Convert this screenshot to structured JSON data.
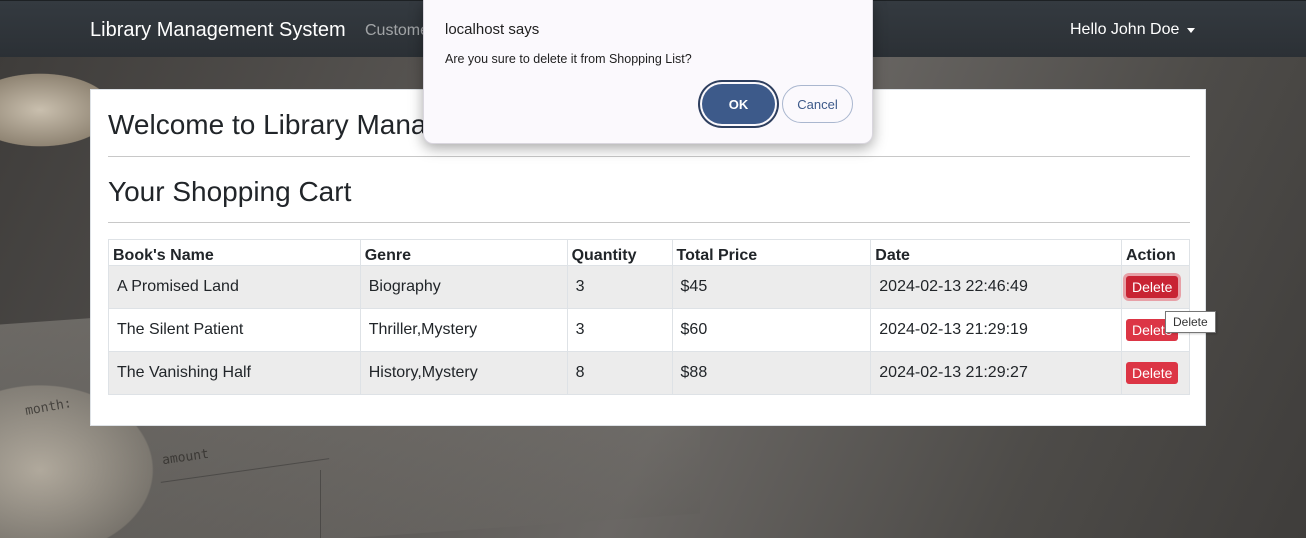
{
  "navbar": {
    "brand": "Library Management System",
    "nav_link": "Custome",
    "user_greeting": "Hello John Doe"
  },
  "main": {
    "welcome_heading": "Welcome to Library Mana",
    "cart_heading": "Your Shopping Cart",
    "table": {
      "headers": [
        "Book's Name",
        "Genre",
        "Quantity",
        "Total Price",
        "Date",
        "Action"
      ],
      "rows": [
        {
          "name": "A Promised Land",
          "genre": "Biography",
          "quantity": "3",
          "price": "$45",
          "date": "2024-02-13 22:46:49",
          "action": "Delete"
        },
        {
          "name": "The Silent Patient",
          "genre": "Thriller,Mystery",
          "quantity": "3",
          "price": "$60",
          "date": "2024-02-13 21:29:19",
          "action": "Delete"
        },
        {
          "name": "The Vanishing Half",
          "genre": "History,Mystery",
          "quantity": "8",
          "price": "$88",
          "date": "2024-02-13 21:29:27",
          "action": "Delete"
        }
      ]
    }
  },
  "tooltip": "Delete",
  "dialog": {
    "title": "localhost says",
    "message": "Are you sure to delete it from Shopping List?",
    "ok_label": "OK",
    "cancel_label": "Cancel"
  },
  "background_text": {
    "month_label": "month:",
    "amount_label": "amount"
  },
  "colors": {
    "navbar": "#343a40",
    "danger": "#dc3545",
    "dialog_primary": "#3d5a8a"
  }
}
